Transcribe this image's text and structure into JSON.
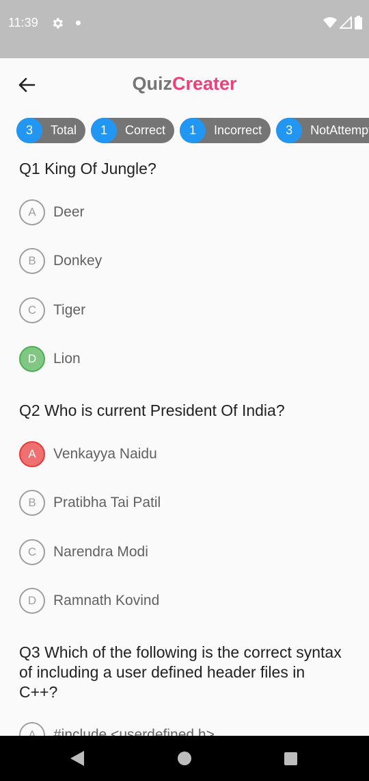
{
  "status_bar": {
    "time": "11:39",
    "icons": [
      "gear-icon",
      "notification-dot-icon",
      "wifi-icon",
      "signal-icon",
      "battery-icon"
    ]
  },
  "app_bar": {
    "back_icon": "arrow-left-icon",
    "title_part1": "Quiz",
    "title_part2": "Creater",
    "title_colors": {
      "part1": "#757575",
      "part2": "#ec407a"
    }
  },
  "stats": [
    {
      "count": "3",
      "label": "Total"
    },
    {
      "count": "1",
      "label": "Correct"
    },
    {
      "count": "1",
      "label": "Incorrect"
    },
    {
      "count": "3",
      "label": "NotAttempted"
    }
  ],
  "colors": {
    "accent": "#2196f3",
    "correct": "#81c784",
    "incorrect": "#ef7070",
    "chip_bg": "#757575"
  },
  "questions": [
    {
      "text": "Q1 King Of Jungle?",
      "options": [
        {
          "letter": "A",
          "text": "Deer",
          "state": "none"
        },
        {
          "letter": "B",
          "text": "Donkey",
          "state": "none"
        },
        {
          "letter": "C",
          "text": "Tiger",
          "state": "none"
        },
        {
          "letter": "D",
          "text": "Lion",
          "state": "correct"
        }
      ]
    },
    {
      "text": "Q2 Who is current President Of India?",
      "options": [
        {
          "letter": "A",
          "text": "Venkayya Naidu",
          "state": "incorrect"
        },
        {
          "letter": "B",
          "text": "Pratibha Tai Patil",
          "state": "none"
        },
        {
          "letter": "C",
          "text": "Narendra Modi",
          "state": "none"
        },
        {
          "letter": "D",
          "text": "Ramnath Kovind",
          "state": "none"
        }
      ]
    },
    {
      "text": "Q3 Which of the following is the correct syntax of including a user defined header files in C++?",
      "options": [
        {
          "letter": "A",
          "text": "#include <userdefined.h>",
          "state": "none"
        }
      ]
    }
  ],
  "nav_bar": {
    "icons": [
      "back-triangle-icon",
      "home-circle-icon",
      "recents-square-icon"
    ]
  }
}
